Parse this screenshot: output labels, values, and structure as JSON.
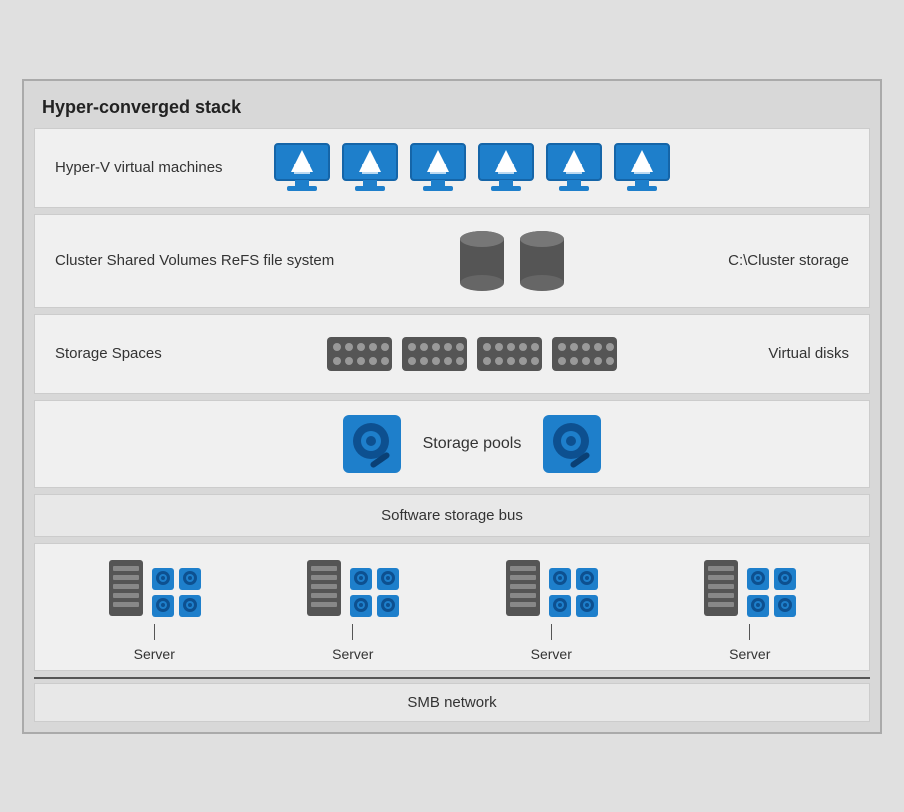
{
  "diagram": {
    "title": "Hyper-converged stack",
    "rows": [
      {
        "id": "hyperv",
        "label": "Hyper-V virtual machines",
        "right_label": "",
        "monitor_count": 6
      },
      {
        "id": "csv",
        "label": "Cluster Shared Volumes ReFS file system",
        "right_label": "C:\\Cluster storage",
        "db_count": 2
      },
      {
        "id": "spaces",
        "label": "Storage Spaces",
        "right_label": "Virtual disks",
        "raid_count": 4
      },
      {
        "id": "pools",
        "label": "Storage pools",
        "hdd_count": 2
      }
    ],
    "bus_label": "Software storage bus",
    "server_label": "Server",
    "server_count": 4,
    "smb_label": "SMB network"
  }
}
